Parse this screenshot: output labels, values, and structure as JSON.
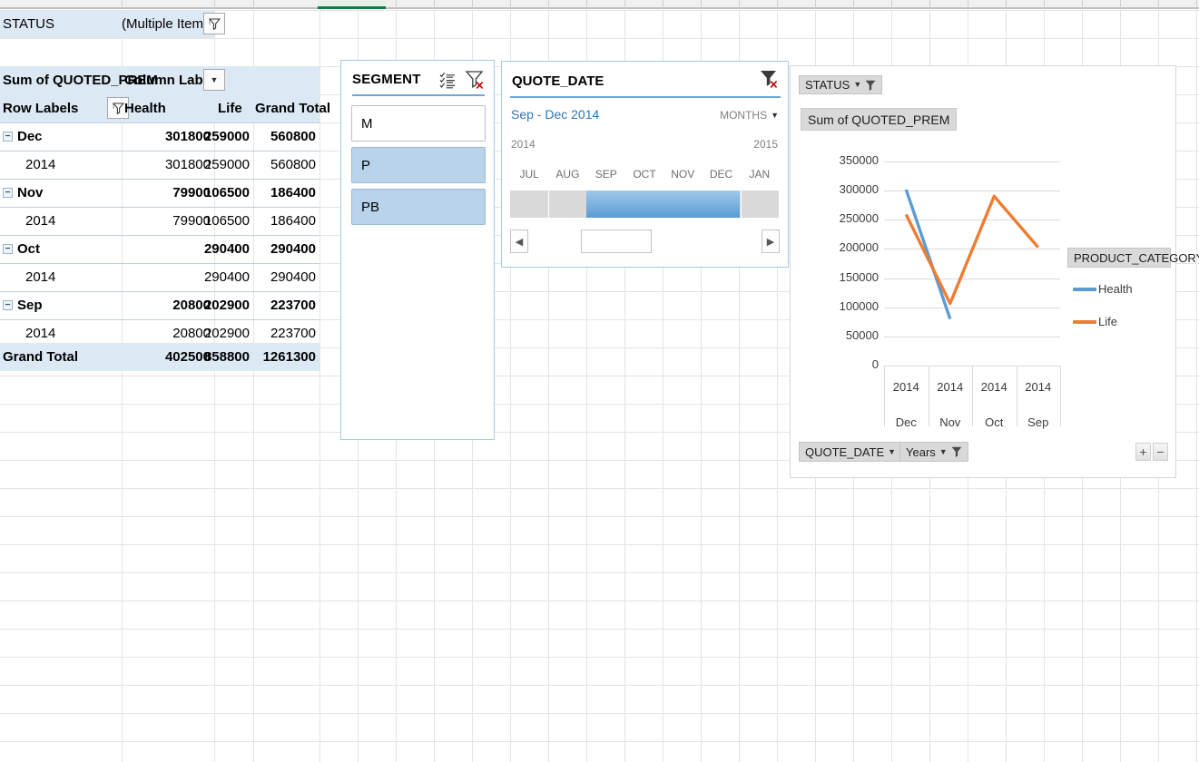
{
  "report_filter": {
    "field_label": "STATUS",
    "value": "(Multiple Items)",
    "filter_icon": "filter-applied-icon"
  },
  "pivot_table": {
    "value_header": "Sum of QUOTED_PREM",
    "column_labels_header": "Column Labels",
    "column_labels_dropdown_icon": "chevron-down-icon",
    "row_labels_header": "Row Labels",
    "row_labels_filter_icon": "filter-applied-icon",
    "columns": [
      "Health",
      "Life",
      "Grand Total"
    ],
    "rows": [
      {
        "label": "Dec",
        "indent": 0,
        "expand": "⊖",
        "bold": true,
        "values": [
          "301800",
          "259000",
          "560800"
        ]
      },
      {
        "label": "2014",
        "indent": 1,
        "expand": "",
        "bold": false,
        "values": [
          "301800",
          "259000",
          "560800"
        ]
      },
      {
        "label": "Nov",
        "indent": 0,
        "expand": "⊖",
        "bold": true,
        "values": [
          "79900",
          "106500",
          "186400"
        ]
      },
      {
        "label": "2014",
        "indent": 1,
        "expand": "",
        "bold": false,
        "values": [
          "79900",
          "106500",
          "186400"
        ]
      },
      {
        "label": "Oct",
        "indent": 0,
        "expand": "⊖",
        "bold": true,
        "values": [
          "",
          "290400",
          "290400"
        ]
      },
      {
        "label": "2014",
        "indent": 1,
        "expand": "",
        "bold": false,
        "values": [
          "",
          "290400",
          "290400"
        ]
      },
      {
        "label": "Sep",
        "indent": 0,
        "expand": "⊖",
        "bold": true,
        "values": [
          "20800",
          "202900",
          "223700"
        ]
      },
      {
        "label": "2014",
        "indent": 1,
        "expand": "",
        "bold": false,
        "values": [
          "20800",
          "202900",
          "223700"
        ]
      }
    ],
    "grand_total": {
      "label": "Grand Total",
      "values": [
        "402500",
        "858800",
        "1261300"
      ]
    }
  },
  "segment_slicer": {
    "title": "SEGMENT",
    "multi_select_icon": "multi-select-icon",
    "clear_filter_icon": "clear-filter-icon",
    "items": [
      {
        "label": "M",
        "selected": false
      },
      {
        "label": "P",
        "selected": true
      },
      {
        "label": "PB",
        "selected": true
      }
    ]
  },
  "quote_date_timeline": {
    "title": "QUOTE_DATE",
    "clear_filter_icon": "clear-filter-icon",
    "selection_caption": "Sep - Dec 2014",
    "level": "MONTHS",
    "level_dropdown_icon": "chevron-down-icon",
    "year_start": "2014",
    "year_end": "2015",
    "months": [
      "JUL",
      "AUG",
      "SEP",
      "OCT",
      "NOV",
      "DEC",
      "JAN"
    ],
    "selected_months": [
      "SEP",
      "OCT",
      "NOV",
      "DEC"
    ],
    "scroll_left_icon": "caret-left-icon",
    "scroll_right_icon": "caret-right-icon"
  },
  "pivot_chart": {
    "status_filter_button": {
      "label": "STATUS",
      "dropdown_icon": "chevron-down-icon",
      "filter_icon": "filter-icon"
    },
    "title": "Sum of QUOTED_PREM",
    "legend_title": "PRODUCT_CATEGORY",
    "legend_dropdown_icon": "chevron-down-icon",
    "field_buttons": [
      {
        "label": "QUOTE_DATE",
        "dropdown_icon": "chevron-down-icon",
        "filter_icon": "filter-icon"
      },
      {
        "label": "Years",
        "dropdown_icon": "chevron-down-icon",
        "filter_icon": "filter-icon"
      }
    ],
    "zoom_in_label": "+",
    "zoom_out_label": "−"
  },
  "chart_data": {
    "type": "line",
    "title": "Sum of QUOTED_PREM",
    "xlabel": "",
    "ylabel": "",
    "ylim": [
      0,
      350000
    ],
    "ytick_step": 50000,
    "yticks": [
      "0",
      "50000",
      "100000",
      "150000",
      "200000",
      "250000",
      "300000",
      "350000"
    ],
    "grid": true,
    "legend_position": "right",
    "legend_title": "PRODUCT_CATEGORY",
    "categories": [
      "Dec",
      "Nov",
      "Oct",
      "Sep"
    ],
    "category_top_level": [
      "2014",
      "2014",
      "2014",
      "2014"
    ],
    "series": [
      {
        "name": "Health",
        "color": "#5b9bd5",
        "values": [
          301800,
          79900,
          null,
          null
        ]
      },
      {
        "name": "Life",
        "color": "#ed7d31",
        "values": [
          259000,
          106500,
          290400,
          202900
        ]
      }
    ]
  },
  "colors": {
    "accent_blue": "#5b9bd5",
    "accent_orange": "#ed7d31",
    "pivot_band": "#dce9f5",
    "slicer_selected": "#b9d4ea",
    "sheet_tab_green": "#107c41"
  }
}
